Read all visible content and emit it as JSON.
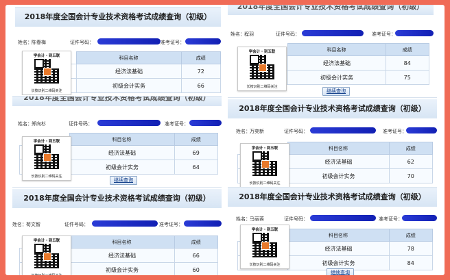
{
  "colors": {
    "frame": "#f06b56",
    "header": "#d7e5f4",
    "redaction": "#1a2ac8",
    "table_header": "#cfe0f3"
  },
  "labels": {
    "name": "姓名：",
    "cert": "证件号码：",
    "ticket": "准考证号：",
    "subject_col": "科目名称",
    "score_col": "成绩",
    "query_button": "继续查询",
    "qr_top": "学会计・到五联",
    "qr_bottom": "长按识别二维码关注",
    "qr_icon": "qr-code-icon"
  },
  "panels": [
    {
      "title": "2018年度全国会计专业技术资格考试成绩查询（初级）",
      "name": "陈春梅",
      "results": [
        {
          "subject": "经济法基础",
          "score": "72"
        },
        {
          "subject": "初级会计实务",
          "score": "66"
        }
      ]
    },
    {
      "title": "2018年度全国会计专业技术资格考试成绩查询（初级）",
      "name": "程羽",
      "results": [
        {
          "subject": "经济法基础",
          "score": "84"
        },
        {
          "subject": "初级会计实务",
          "score": "75"
        }
      ]
    },
    {
      "title": "2018年度全国会计专业技术资格考试成绩查询（初级）",
      "name": "郑向杉",
      "results": [
        {
          "subject": "经济法基础",
          "score": "69"
        },
        {
          "subject": "初级会计实务",
          "score": "64"
        }
      ]
    },
    {
      "title": "2018年度全国会计专业技术资格考试成绩查询（初级）",
      "name": "万奕新",
      "results": [
        {
          "subject": "经济法基础",
          "score": "62"
        },
        {
          "subject": "初级会计实务",
          "score": "70"
        }
      ]
    },
    {
      "title": "2018年度全国会计专业技术资格考试成绩查询（初级）",
      "name": "荀文智",
      "results": [
        {
          "subject": "经济法基础",
          "score": "66"
        },
        {
          "subject": "初级会计实务",
          "score": "60"
        }
      ]
    },
    {
      "title": "2018年度全国会计专业技术资格考试成绩查询（初级）",
      "name": "马丽蓉",
      "results": [
        {
          "subject": "经济法基础",
          "score": "78"
        },
        {
          "subject": "初级会计实务",
          "score": "84"
        }
      ]
    }
  ]
}
